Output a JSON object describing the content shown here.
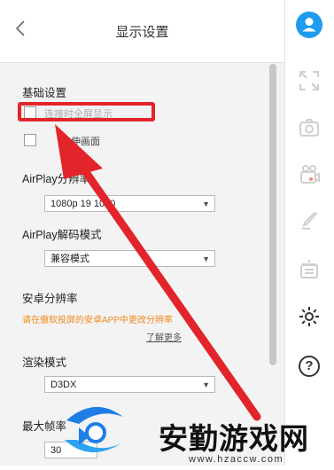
{
  "header": {
    "title": "显示设置",
    "back_icon": "chevron-left-icon"
  },
  "basic": {
    "heading": "基础设置",
    "fullscreen_label": "连接时全屏显示",
    "stretch_label": "拉伸画面"
  },
  "airplay_resolution": {
    "label": "AirPlay分辨率",
    "value": "1080p 19  1080"
  },
  "airplay_decode": {
    "label": "AirPlay解码模式",
    "value": "兼容模式"
  },
  "android_resolution": {
    "label": "安卓分辨率",
    "note": "请在傲软投屏的安卓APP中更改分辨率",
    "link": "了解更多"
  },
  "render_mode": {
    "label": "渲染模式",
    "value": "D3DX"
  },
  "max_fps": {
    "label": "最大帧率",
    "value": "30"
  },
  "sidebar": {
    "icons": [
      "user-icon",
      "fullscreen-icon",
      "camera-icon",
      "record-icon",
      "brush-icon",
      "whiteboard-icon",
      "settings-icon",
      "help-icon"
    ],
    "help_glyph": "?"
  },
  "watermark": {
    "text": "安勤游戏网",
    "url": "www.hzaccw.com"
  },
  "colors": {
    "accent": "#1e9cf0",
    "highlight": "#e3242b",
    "note": "#f08a1c"
  }
}
